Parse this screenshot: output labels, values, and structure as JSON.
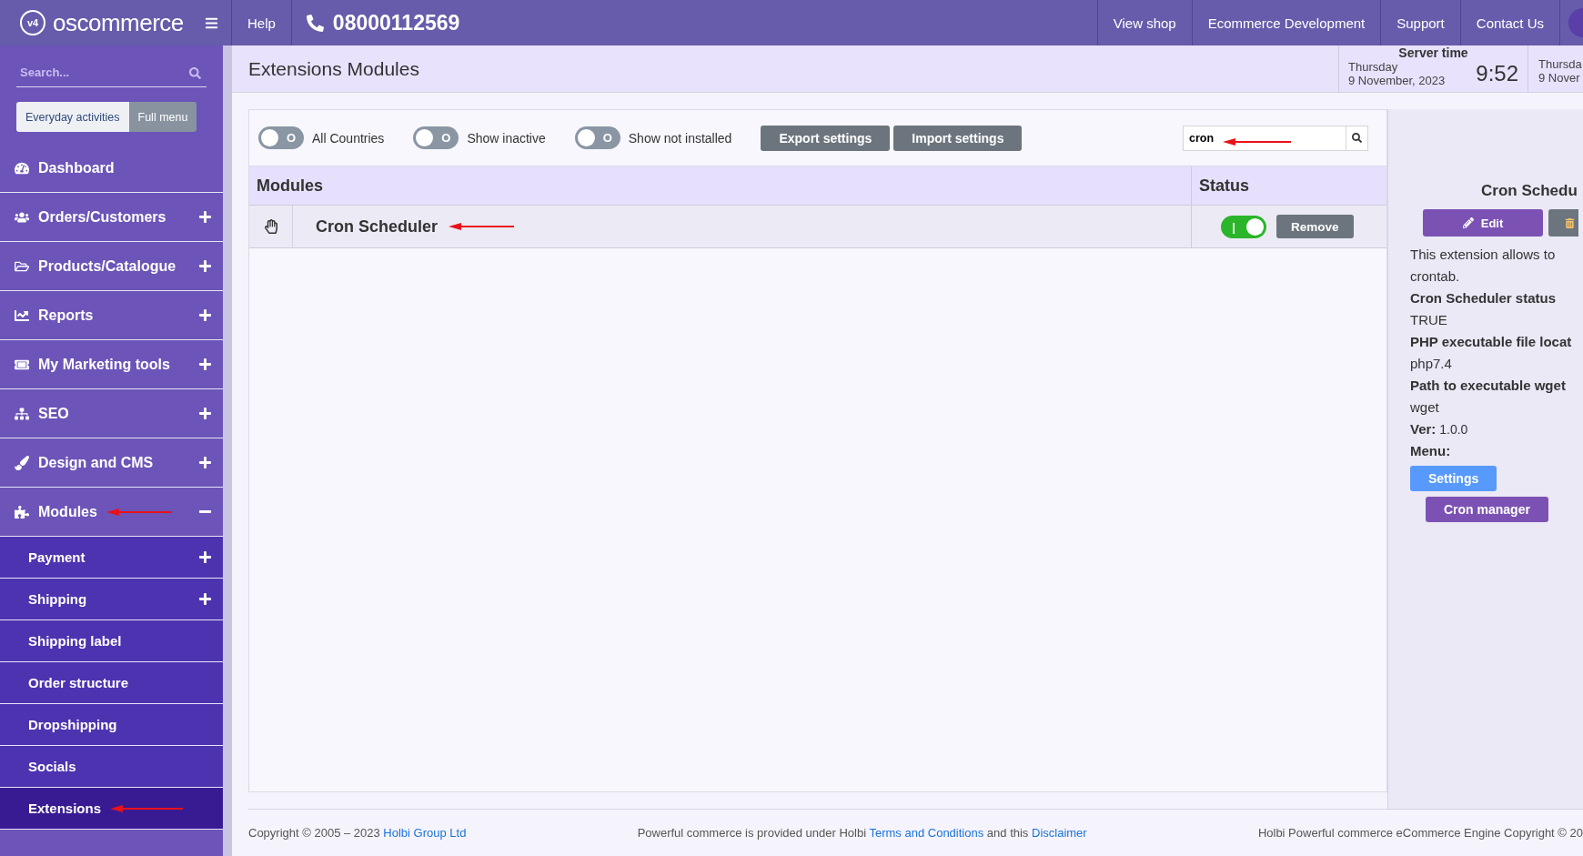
{
  "topbar": {
    "logo": "oscommerce",
    "logo_badge": "v4",
    "help": "Help",
    "phone": "08000112569",
    "nav": [
      "View shop",
      "Ecommerce Development",
      "Support",
      "Contact Us"
    ]
  },
  "sidebar": {
    "search": {
      "placeholder": "Search..."
    },
    "menu_tabs": [
      {
        "label": "Everyday activities",
        "selected": true
      },
      {
        "label": "Full menu",
        "selected": false
      }
    ],
    "items": [
      {
        "label": "Dashboard",
        "expandable": false,
        "expanded": false,
        "annotated": false
      },
      {
        "label": "Orders/Customers",
        "expandable": true,
        "expanded": false,
        "annotated": false
      },
      {
        "label": "Products/Catalogue",
        "expandable": true,
        "expanded": false,
        "annotated": false
      },
      {
        "label": "Reports",
        "expandable": true,
        "expanded": false,
        "annotated": false
      },
      {
        "label": "My Marketing tools",
        "expandable": true,
        "expanded": false,
        "annotated": false
      },
      {
        "label": "SEO",
        "expandable": true,
        "expanded": false,
        "annotated": false
      },
      {
        "label": "Design and CMS",
        "expandable": true,
        "expanded": false,
        "annotated": false
      },
      {
        "label": "Modules",
        "expandable": true,
        "expanded": true,
        "annotated": true,
        "children": [
          {
            "label": "Payment",
            "expandable": true,
            "selected": false,
            "annotated": false
          },
          {
            "label": "Shipping",
            "expandable": true,
            "selected": false,
            "annotated": false
          },
          {
            "label": "Shipping label",
            "expandable": false,
            "selected": false,
            "annotated": false
          },
          {
            "label": "Order structure",
            "expandable": false,
            "selected": false,
            "annotated": false
          },
          {
            "label": "Dropshipping",
            "expandable": false,
            "selected": false,
            "annotated": false
          },
          {
            "label": "Socials",
            "expandable": false,
            "selected": false,
            "annotated": false
          },
          {
            "label": "Extensions",
            "expandable": false,
            "selected": true,
            "annotated": true
          }
        ]
      }
    ]
  },
  "page": {
    "title": "Extensions Modules",
    "server_time": {
      "label": "Server time",
      "day": "Thursday",
      "date": "9 November, 2023",
      "time": "9:52"
    },
    "server_time_2": {
      "day": "Thursda",
      "date": "9 Nover"
    }
  },
  "toolbar": {
    "toggles": [
      {
        "label": "All Countries",
        "on": false,
        "mark": "O"
      },
      {
        "label": "Show inactive",
        "on": false,
        "mark": "O"
      },
      {
        "label": "Show not installed",
        "on": false,
        "mark": "O"
      }
    ],
    "buttons": [
      "Export settings",
      "Import settings"
    ],
    "search": {
      "value": "cron",
      "annotated": true
    }
  },
  "table": {
    "columns": [
      "Modules",
      "Status"
    ],
    "rows": [
      {
        "name": "Cron Scheduler",
        "annotated": true,
        "status": {
          "on": true,
          "mark": "|"
        },
        "action": "Remove"
      }
    ]
  },
  "details": {
    "title": "Cron Schedu",
    "edit": "Edit",
    "description": [
      "This extension allows to",
      "crontab."
    ],
    "fields": [
      {
        "label": "Cron Scheduler status",
        "value": "TRUE"
      },
      {
        "label": "PHP executable file locat",
        "value": "php7.4"
      },
      {
        "label": "Path to executable wget",
        "value": "wget"
      }
    ],
    "version": {
      "label": "Ver:",
      "value": "1.0.0"
    },
    "menu_label": "Menu:",
    "menu_buttons": [
      {
        "label": "Settings",
        "kind": "primary"
      },
      {
        "label": "Cron manager",
        "kind": "secondary"
      }
    ]
  },
  "footer": {
    "left": [
      {
        "text": "Copyright © 2005 – 2023"
      },
      {
        "link": "Holbi Group Ltd"
      }
    ],
    "middle": [
      {
        "text": "Powerful commerce is provided under Holbi"
      },
      {
        "link": "Terms and Conditions"
      },
      {
        "text": "and this"
      },
      {
        "link": "Disclaimer"
      }
    ],
    "right": [
      {
        "text": "Holbi Powerful commerce eCommerce Engine Copyright © 20"
      }
    ]
  }
}
